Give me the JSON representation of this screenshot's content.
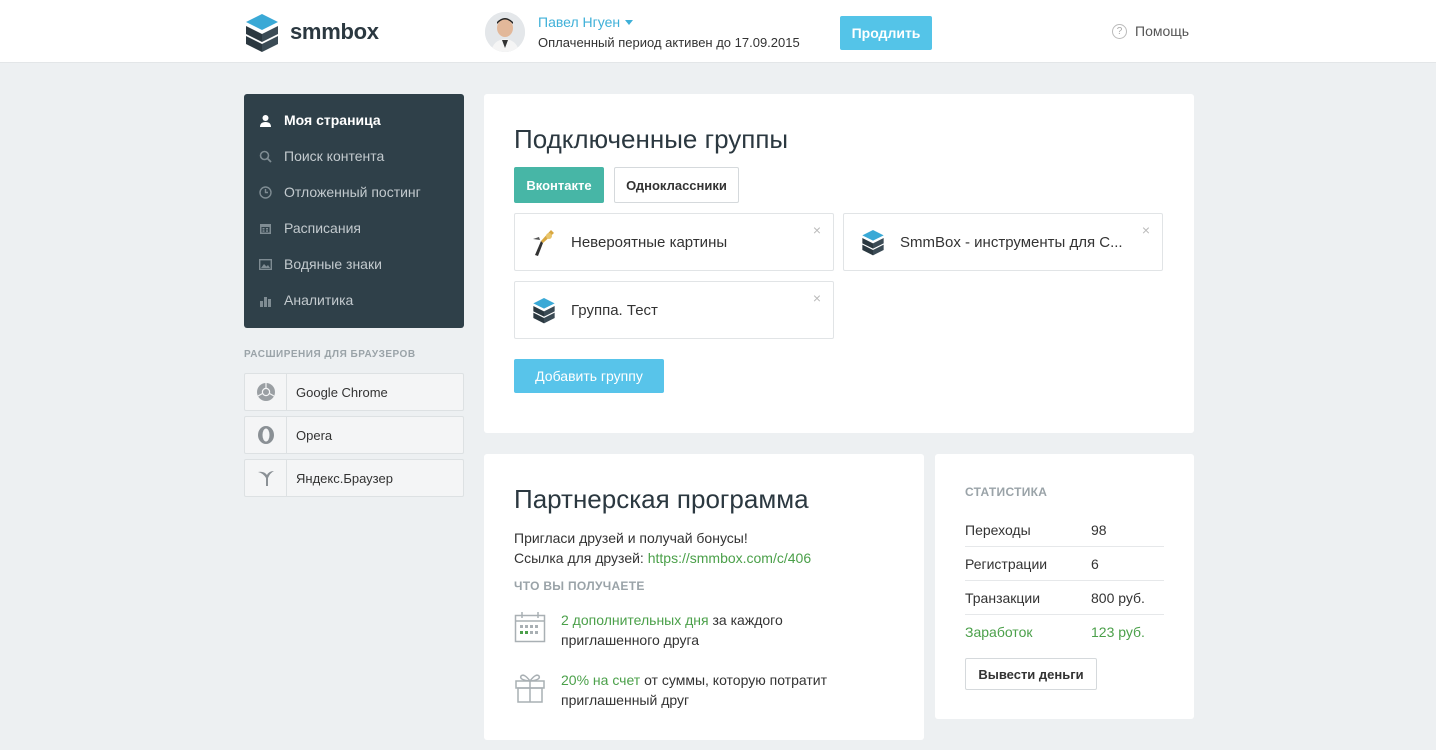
{
  "header": {
    "logo_text": "smmbox",
    "user_name": "Павел Нгуен",
    "period_text": "Оплаченный период активен до 17.09.2015",
    "renew_label": "Продлить",
    "help_label": "Помощь",
    "help_icon_glyph": "?"
  },
  "sidebar": {
    "items": [
      {
        "label": "Моя страница",
        "icon": "user-icon",
        "active": true
      },
      {
        "label": "Поиск контента",
        "icon": "search-icon",
        "active": false
      },
      {
        "label": "Отложенный постинг",
        "icon": "clock-icon",
        "active": false
      },
      {
        "label": "Расписания",
        "icon": "calendar-icon",
        "active": false
      },
      {
        "label": "Водяные знаки",
        "icon": "image-icon",
        "active": false
      },
      {
        "label": "Аналитика",
        "icon": "bar-chart-icon",
        "active": false
      }
    ],
    "extensions_title": "РАСШИРЕНИЯ ДЛЯ БРАУЗЕРОВ",
    "extensions": [
      {
        "label": "Google Chrome",
        "icon": "chrome-icon"
      },
      {
        "label": "Opera",
        "icon": "opera-icon"
      },
      {
        "label": "Яндекс.Браузер",
        "icon": "yandex-browser-icon"
      }
    ]
  },
  "groups": {
    "title": "Подключенные группы",
    "tabs": [
      "Вконтакте",
      "Одноклассники"
    ],
    "active_tab": "Вконтакте",
    "items": [
      {
        "name": "Невероятные картины",
        "icon": "painting-icon"
      },
      {
        "name": "SmmBox - инструменты для С...",
        "icon": "smmbox-logo-icon"
      },
      {
        "name": "Группа. Тест",
        "icon": "smmbox-logo-icon"
      }
    ],
    "close_glyph": "×",
    "add_label": "Добавить группу"
  },
  "partner": {
    "title": "Партнерская программа",
    "invite_text": "Пригласи друзей и получай бонусы!",
    "link_prefix": "Ссылка для друзей: ",
    "link": "https://smmbox.com/c/406",
    "get_title": "ЧТО ВЫ ПОЛУЧАЕТЕ",
    "benefits": [
      {
        "highlight": "2 дополнительных дня",
        "rest_line1": " за каждого",
        "line2": "приглашенного друга",
        "icon": "calendar-icon"
      },
      {
        "highlight": "20% на счет",
        "rest_line1": " от суммы, которую потратит",
        "line2": "приглашенный друг",
        "icon": "gift-icon"
      }
    ]
  },
  "stats": {
    "title": "СТАТИСТИКА",
    "rows": [
      {
        "label": "Переходы",
        "value": "98"
      },
      {
        "label": "Регистрации",
        "value": "6"
      },
      {
        "label": "Транзакции",
        "value": "800 руб."
      },
      {
        "label": "Заработок",
        "value": "123 руб."
      }
    ],
    "withdraw_label": "Вывести деньги"
  },
  "colors": {
    "accent_blue": "#54c4e8",
    "accent_green": "#4ba04a",
    "tab_active": "#47b6a6",
    "sidebar_bg": "#2f4049"
  }
}
